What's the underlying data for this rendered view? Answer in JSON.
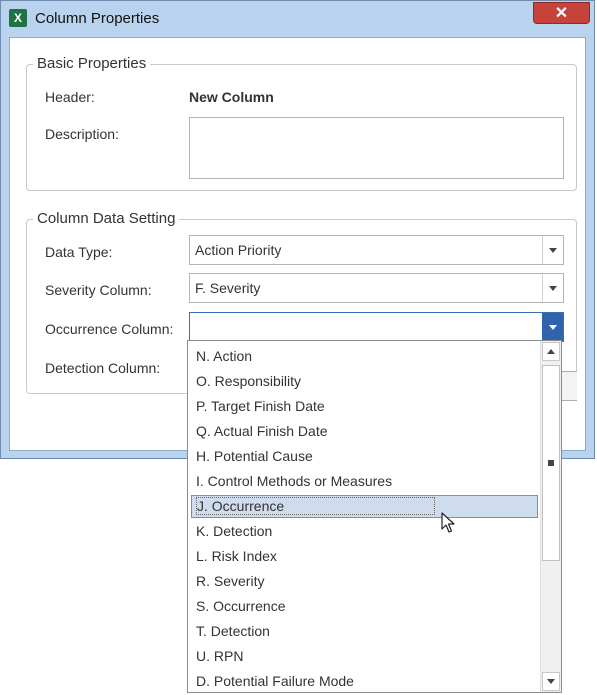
{
  "window": {
    "title": "Column Properties",
    "close_label": "✕",
    "app_icon_letter": "X"
  },
  "basic": {
    "legend": "Basic Properties",
    "header_label": "Header:",
    "header_value": "New Column",
    "description_label": "Description:",
    "description_value": ""
  },
  "data_setting": {
    "legend": "Column Data Setting",
    "data_type_label": "Data Type:",
    "data_type_value": "Action Priority",
    "severity_label": "Severity Column:",
    "severity_value": "F. Severity",
    "occurrence_label": "Occurrence Column:",
    "occurrence_value": "",
    "detection_label": "Detection Column:"
  },
  "dropdown": {
    "selected_index": 6,
    "items": [
      "N. Action",
      "O. Responsibility",
      "P. Target Finish Date",
      "Q. Actual Finish Date",
      "H. Potential Cause",
      "I. Control Methods or Measures",
      "J. Occurrence",
      "K. Detection",
      "L. Risk Index",
      "R. Severity",
      "S. Occurrence",
      "T. Detection",
      "U. RPN",
      "D. Potential Failure Mode"
    ]
  },
  "colors": {
    "window_frame": "#b9d3ee",
    "close_button": "#c7423a",
    "active_combo_arrow": "#2f63ab",
    "selection_bg": "#cfdcee"
  }
}
